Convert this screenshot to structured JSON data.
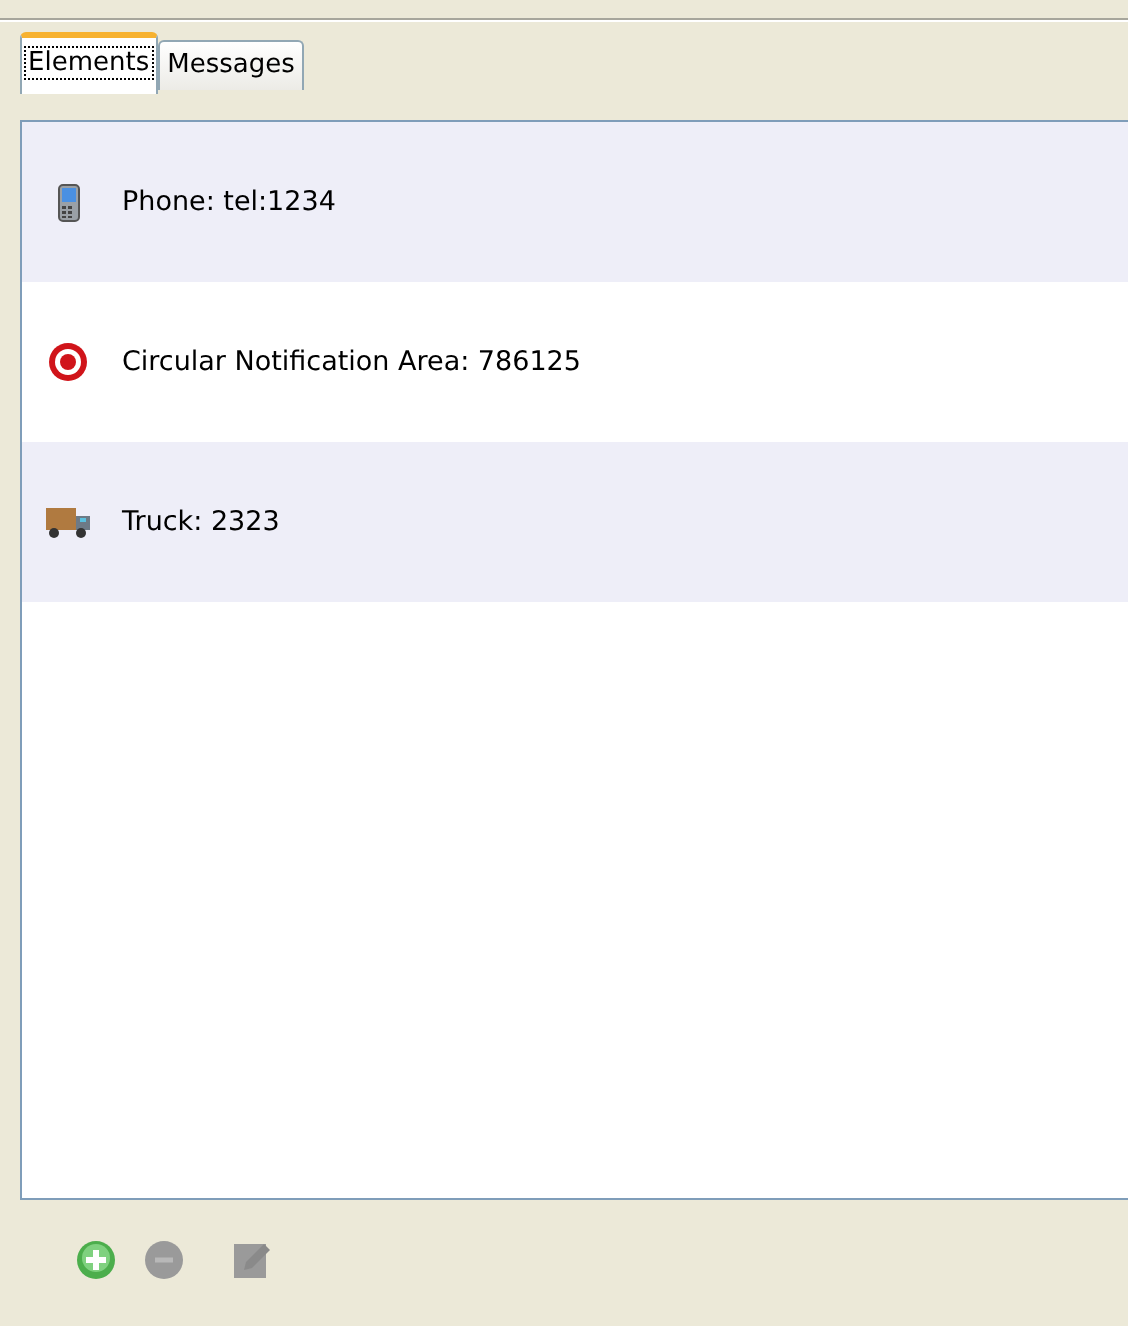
{
  "tabs": [
    {
      "label": "Elements",
      "selected": true
    },
    {
      "label": "Messages",
      "selected": false
    }
  ],
  "elements": [
    {
      "kind": "phone",
      "label": "Phone: tel:1234"
    },
    {
      "kind": "target",
      "label": "Circular Notification Area: 786125"
    },
    {
      "kind": "truck",
      "label": "Truck: 2323"
    }
  ],
  "toolbar": [
    {
      "kind": "add",
      "disabled": false
    },
    {
      "kind": "remove",
      "disabled": true
    },
    {
      "kind": "edit",
      "disabled": true
    }
  ]
}
